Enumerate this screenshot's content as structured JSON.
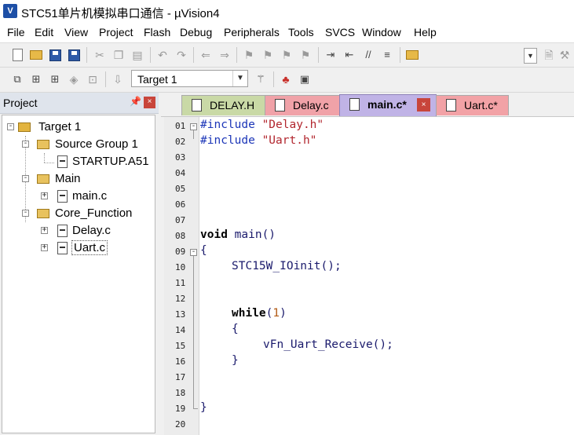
{
  "window": {
    "title": "STC51单片机模拟串口通信  - µVision4",
    "app_icon": "uv4-app-icon"
  },
  "menu": [
    "File",
    "Edit",
    "View",
    "Project",
    "Flash",
    "Debug",
    "Peripherals",
    "Tools",
    "SVCS",
    "Window",
    "Help"
  ],
  "toolbar": {
    "target_value": "Target 1"
  },
  "project_panel": {
    "title": "Project",
    "tree": {
      "root": "Target 1",
      "groups": [
        {
          "name": "Source Group 1",
          "files": [
            "STARTUP.A51"
          ]
        },
        {
          "name": "Main",
          "files": [
            "main.c"
          ]
        },
        {
          "name": "Core_Function",
          "files": [
            "Delay.c",
            "Uart.c"
          ]
        }
      ]
    }
  },
  "tabs": [
    {
      "label": "DELAY.H",
      "color": "#c9d9a6"
    },
    {
      "label": "Delay.c",
      "color": "#f0a2a8"
    },
    {
      "label": "main.c*",
      "color": "#c0b3e6",
      "active": true
    },
    {
      "label": "Uart.c*",
      "color": "#f2a2a6"
    }
  ],
  "editor": {
    "line_numbers": [
      "01",
      "02",
      "03",
      "04",
      "05",
      "06",
      "07",
      "08",
      "09",
      "10",
      "11",
      "12",
      "13",
      "14",
      "15",
      "16",
      "17",
      "18",
      "19",
      "20"
    ],
    "code": {
      "l1_directive": "#include",
      "l1_string": "\"Delay.h\"",
      "l2_directive": "#include",
      "l2_string": "\"Uart.h\"",
      "l8_keyword": "void",
      "l8_rest": " main()",
      "l9_text": "{",
      "l10_text": "STC15W_IOinit();",
      "l13_keyword": "while",
      "l13_paren_open": "(",
      "l13_number": "1",
      "l13_paren_close": ")",
      "l14_text": "{",
      "l15_text": "vFn_Uart_Receive();",
      "l16_text": "}",
      "l19_text": "}"
    }
  }
}
